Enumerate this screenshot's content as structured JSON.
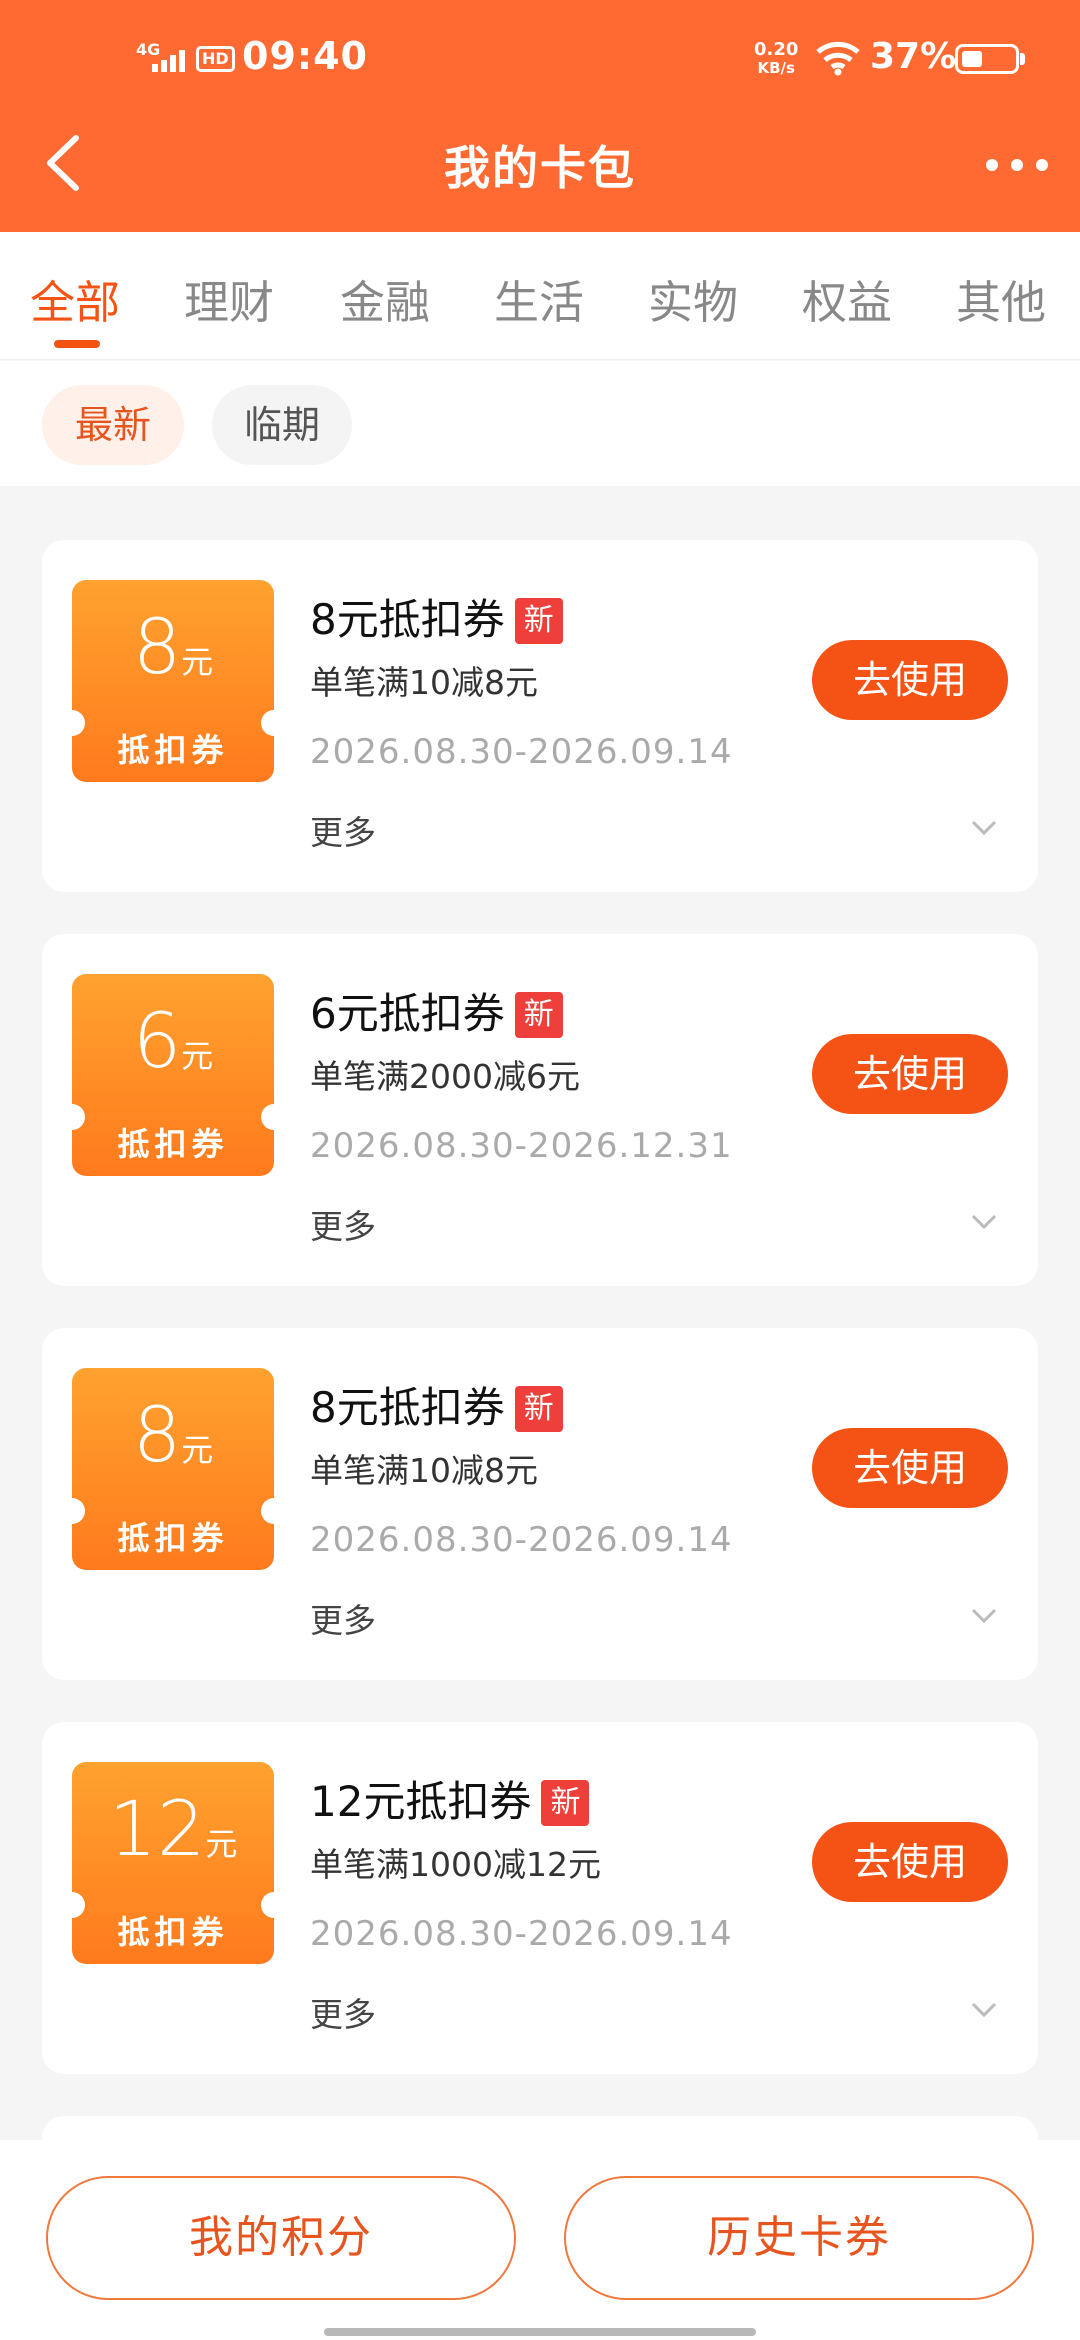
{
  "status": {
    "net_type": "4G",
    "hd": "HD",
    "time": "09:40",
    "speed_value": "0.20",
    "speed_unit": "KB/s",
    "battery": "37%"
  },
  "header": {
    "title": "我的卡包"
  },
  "tabs": [
    "全部",
    "理财",
    "金融",
    "生活",
    "实物",
    "权益",
    "其他"
  ],
  "active_tab": "全部",
  "filters": {
    "latest": "最新",
    "expiring": "临期"
  },
  "coupons": [
    {
      "amount": "8",
      "unit": "元",
      "type": "抵扣券",
      "title": "8元抵扣券",
      "badge": "新",
      "desc": "单笔满10减8元",
      "date": "2026.08.30-2026.09.14",
      "more": "更多",
      "action": "去使用"
    },
    {
      "amount": "6",
      "unit": "元",
      "type": "抵扣券",
      "title": "6元抵扣券",
      "badge": "新",
      "desc": "单笔满2000减6元",
      "date": "2026.08.30-2026.12.31",
      "more": "更多",
      "action": "去使用"
    },
    {
      "amount": "8",
      "unit": "元",
      "type": "抵扣券",
      "title": "8元抵扣券",
      "badge": "新",
      "desc": "单笔满10减8元",
      "date": "2026.08.30-2026.09.14",
      "more": "更多",
      "action": "去使用"
    },
    {
      "amount": "12",
      "unit": "元",
      "type": "抵扣券",
      "title": "12元抵扣券",
      "badge": "新",
      "desc": "单笔满1000减12元",
      "date": "2026.08.30-2026.09.14",
      "more": "更多",
      "action": "去使用"
    }
  ],
  "bottom": {
    "points": "我的积分",
    "history": "历史卡券"
  },
  "colors": {
    "accent": "#ff6a33",
    "button": "#f45315",
    "badge": "#ee3f3a"
  },
  "icons": [
    "back-arrow-icon",
    "more-dots-icon",
    "chevron-down-icon",
    "wifi-icon",
    "signal-icon",
    "battery-icon"
  ]
}
